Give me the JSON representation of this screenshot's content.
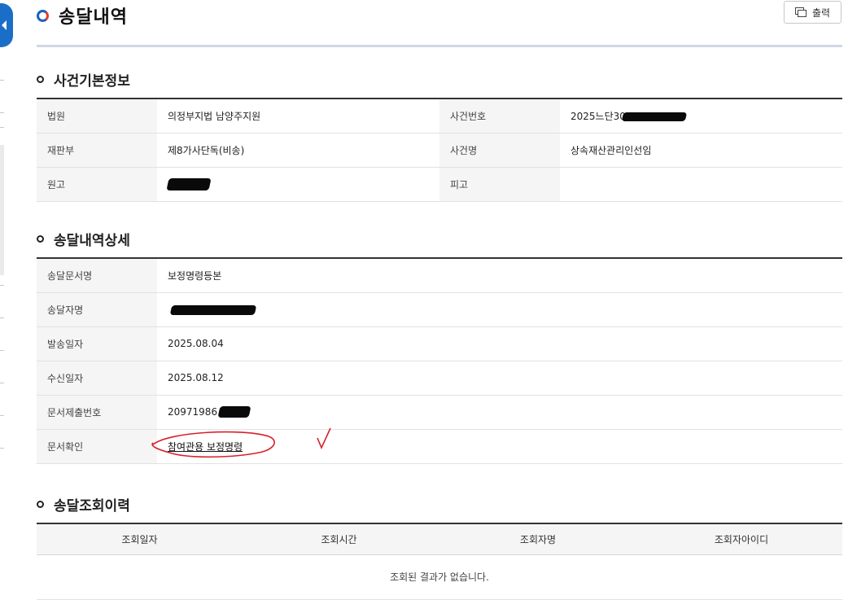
{
  "page": {
    "title": "송달내역",
    "print_label": "출력"
  },
  "case_info": {
    "title": "사건기본정보",
    "court_label": "법원",
    "court_value": "의정부지법 남양주지원",
    "case_no_label": "사건번호",
    "case_no_value": "2025느단30",
    "division_label": "재판부",
    "division_value": "제8가사단독(비송)",
    "case_name_label": "사건명",
    "case_name_value": "상속재산관리인선임",
    "plaintiff_label": "원고",
    "plaintiff_value": "",
    "defendant_label": "피고",
    "defendant_value": ""
  },
  "delivery_detail": {
    "title": "송달내역상세",
    "doc_name_label": "송달문서명",
    "doc_name_value": "보정명령등본",
    "recipient_label": "송달자명",
    "recipient_value": "",
    "sent_date_label": "발송일자",
    "sent_date_value": "2025.08.04",
    "recv_date_label": "수신일자",
    "recv_date_value": "2025.08.12",
    "doc_no_label": "문서제출번호",
    "doc_no_value": "20971986",
    "doc_check_label": "문서확인",
    "doc_check_value": "참여관용 보정명령"
  },
  "history": {
    "title": "송달조회이력",
    "columns": [
      "조회일자",
      "조회시간",
      "조회자명",
      "조회자아이디"
    ],
    "empty_message": "조회된 결과가 없습니다."
  },
  "colors": {
    "accent_blue": "#1d5fbf",
    "accent_red": "#e3402b",
    "annotation_red": "#d8202a",
    "sidebar_blue": "#1b6ec8"
  },
  "icons": {
    "print": "printer-icon",
    "title": "title-ring-icon",
    "section": "section-ring-icon",
    "sidebar": "chevron-left-icon"
  }
}
